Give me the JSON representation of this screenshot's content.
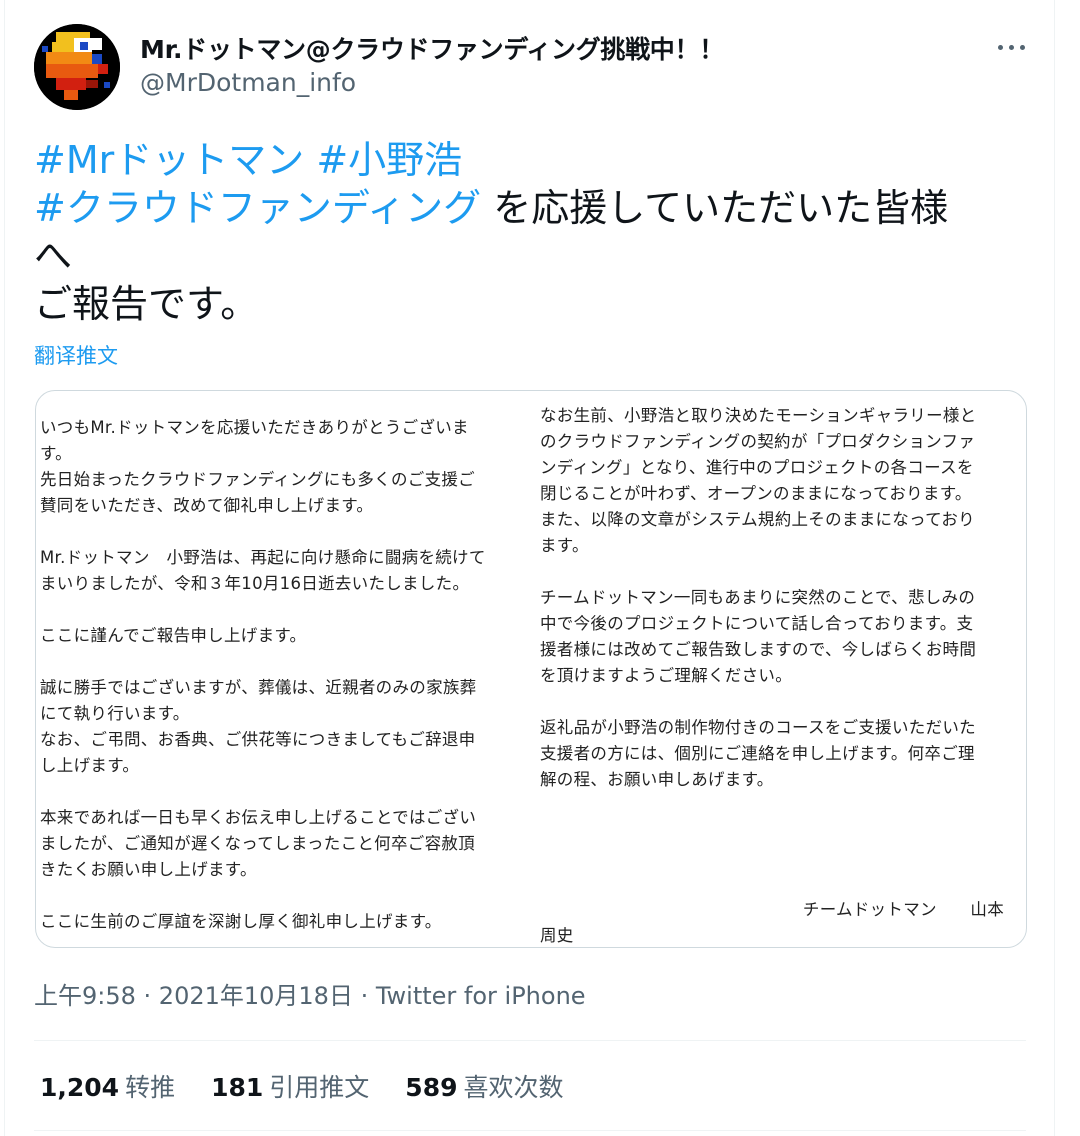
{
  "author": {
    "display_name": "Mr.ドットマン@クラウドファンディング挑戦中！！",
    "handle": "@MrDotman_info"
  },
  "tweet": {
    "hashtag1": "#Mrドットマン",
    "hashtag2": "#小野浩",
    "hashtag3": "#クラウドファンディング",
    "text_a": " を応援していただいた皆様",
    "text_b": "へ",
    "text_c": "ご報告です。",
    "translate_label": "翻译推文"
  },
  "image": {
    "left_lines": [
      "いつもMr.ドットマンを応援いただきありがとうございま",
      "す。",
      "先日始まったクラウドファンディングにも多くのご支援ご",
      "賛同をいただき、改めて御礼申し上げます。",
      "",
      "Mr.ドットマン　小野浩は、再起に向け懸命に闘病を続けて",
      "まいりましたが、令和３年10月16日逝去いたしました。",
      "",
      "ここに謹んでご報告申し上げます。",
      "",
      "誠に勝手ではございますが、葬儀は、近親者のみの家族葬",
      "にて執り行います。",
      "なお、ご弔問、お香典、ご供花等につきましてもご辞退申",
      "し上げます。",
      "",
      "本来であれば一日も早くお伝え申し上げることではござい",
      "ましたが、ご通知が遅くなってしまったこと何卒ご容赦頂",
      "きたくお願い申し上げます。",
      "",
      "ここに生前のご厚誼を深謝し厚く御礼申し上げます。"
    ],
    "right_lines": [
      "なお生前、小野浩と取り決めたモーションギャラリー様と",
      "のクラウドファンディングの契約が「プロダクションファ",
      "ンディング」となり、進行中のプロジェクトの各コースを",
      "閉じることが叶わず、オープンのままになっております。",
      "また、以降の文章がシステム規約上そのままになっており",
      "ます。",
      "",
      "チームドットマン一同もあまりに突然のことで、悲しみの",
      "中で今後のプロジェクトについて話し合っております。支",
      "援者様には改めてご報告致しますので、今しばらくお時間",
      "を頂けますようご理解ください。",
      "",
      "返礼品が小野浩の制作物付きのコースをご支援いただいた",
      "支援者の方には、個別にご連絡を申し上げます。何卒ご理",
      "解の程、お願い申しあげます。"
    ],
    "signature": "チームドットマン　　山本",
    "signature_name": "周史"
  },
  "meta": {
    "time": "上午9:58",
    "sep1": " · ",
    "date": "2021年10月18日",
    "sep2": " · ",
    "source": "Twitter for iPhone"
  },
  "stats": {
    "retweets_count": "1,204",
    "retweets_label": "转推",
    "quotes_count": "181",
    "quotes_label": "引用推文",
    "likes_count": "589",
    "likes_label": "喜欢次数"
  }
}
